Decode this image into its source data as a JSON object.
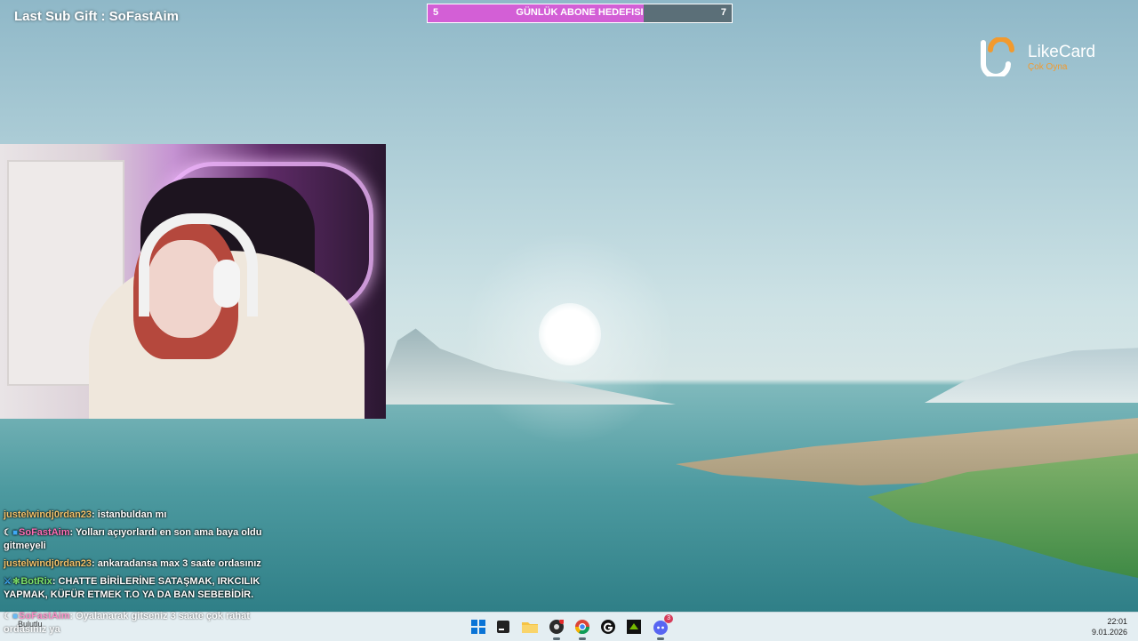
{
  "overlay": {
    "last_sub_gift": "Last Sub Gift : SoFastAim",
    "goal": {
      "current": "5",
      "title": "GÜNLÜK ABONE HEDEFISI",
      "target": "7",
      "progress": 0.71,
      "fill_color": "#d35fd6"
    }
  },
  "logo": {
    "brand": "LikeCard",
    "tagline": "Çok Oyna",
    "accent": "#f29a2e"
  },
  "webcam": {
    "label": "webcam-feed"
  },
  "chat": {
    "messages": [
      {
        "user": "justelwindj0rdan23",
        "badges": [],
        "text": "istanbuldan mı"
      },
      {
        "user": "SoFastAim",
        "badges": [
          "moon-badge",
          "cube-badge"
        ],
        "text": "Yolları açıyorlardı en son ama baya oldu gitmeyeli"
      },
      {
        "user": "justelwindj0rdan23",
        "badges": [],
        "text": "ankaradansa max 3 saate ordasınız"
      },
      {
        "user": "BotRix",
        "badges": [
          "sword-badge",
          "gear-badge"
        ],
        "text": "CHATTE BİRİLERİNE SATAŞMAK, IRKCILIK YAPMAK, KÜFÜR ETMEK T.O YA DA BAN SEBEBİDİR."
      },
      {
        "user": "SoFastAim",
        "badges": [
          "moon-badge",
          "cube-badge"
        ],
        "text": "Oyalanarak gitseniz 3 saate çok rahat ordasınız ya"
      }
    ]
  },
  "taskbar": {
    "weather": "Bulutlu",
    "apps": [
      {
        "name": "windows-start-icon"
      },
      {
        "name": "terminal-icon"
      },
      {
        "name": "file-explorer-icon"
      },
      {
        "name": "obs-icon"
      },
      {
        "name": "chrome-icon"
      },
      {
        "name": "g-hub-icon"
      },
      {
        "name": "nvidia-icon"
      },
      {
        "name": "discord-icon",
        "badge": "3"
      }
    ],
    "time": "22:01",
    "date": "9.01.2026"
  }
}
